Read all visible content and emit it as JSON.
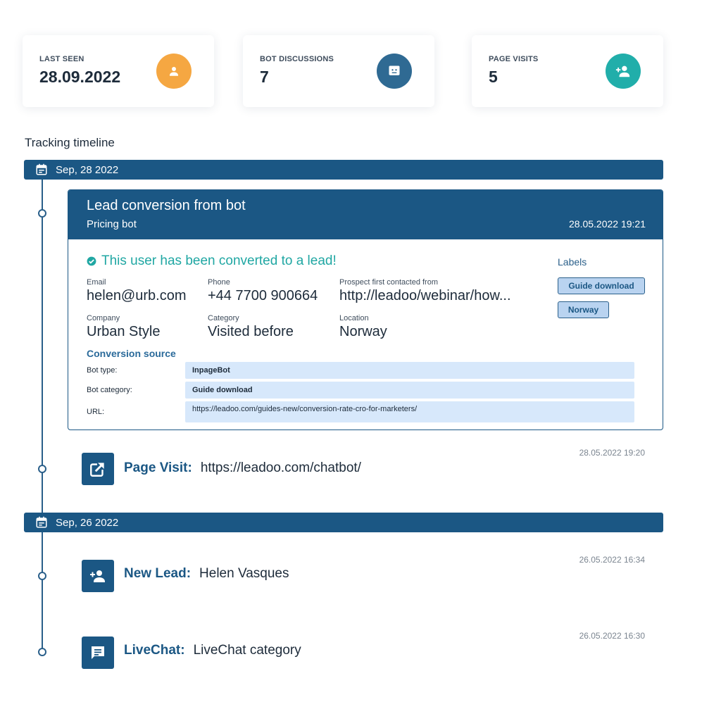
{
  "stats": [
    {
      "label": "LAST SEEN",
      "value": "28.09.2022",
      "icon": "person-icon",
      "color": "#f5a742"
    },
    {
      "label": "BOT DISCUSSIONS",
      "value": "7",
      "icon": "chat-bot-icon",
      "color": "#2f6a93"
    },
    {
      "label": "PAGE VISITS",
      "value": "5",
      "icon": "person-add-icon",
      "color": "#21aeaa"
    }
  ],
  "section_title": "Tracking timeline",
  "dates": [
    "Sep, 28 2022",
    "Sep, 26 2022"
  ],
  "lead_card": {
    "title": "Lead conversion from bot",
    "subtitle": "Pricing bot",
    "time": "28.05.2022 19:21",
    "converted_text": "This user has been converted to a lead!",
    "fields": {
      "email": {
        "label": "Email",
        "value": "helen@urb.com"
      },
      "phone": {
        "label": "Phone",
        "value": "+44 7700 900664"
      },
      "prospect": {
        "label": "Prospect first contacted from",
        "value": "http://leadoo/webinar/how..."
      },
      "company": {
        "label": "Company",
        "value": "Urban Style"
      },
      "category": {
        "label": "Category",
        "value": "Visited before"
      },
      "location": {
        "label": "Location",
        "value": "Norway"
      }
    },
    "labels_title": "Labels",
    "labels": [
      "Guide download",
      "Norway"
    ],
    "conversion_source_title": "Conversion source",
    "conversion_source": [
      {
        "label": "Bot type:",
        "value": "InpageBot"
      },
      {
        "label": "Bot category:",
        "value": "Guide download"
      },
      {
        "label": "URL:",
        "value": "https://leadoo.com/guides-new/conversion-rate-cro-for-marketers/"
      }
    ]
  },
  "events": [
    {
      "kind": "Page Visit:",
      "value": "https://leadoo.com/chatbot/",
      "time": "28.05.2022 19:20",
      "icon": "external-link-icon"
    },
    {
      "kind": "New Lead:",
      "value": "Helen Vasques",
      "time": "26.05.2022 16:34",
      "icon": "person-add-icon"
    },
    {
      "kind": "LiveChat:",
      "value": "LiveChat category",
      "time": "26.05.2022 16:30",
      "icon": "chat-icon"
    }
  ]
}
